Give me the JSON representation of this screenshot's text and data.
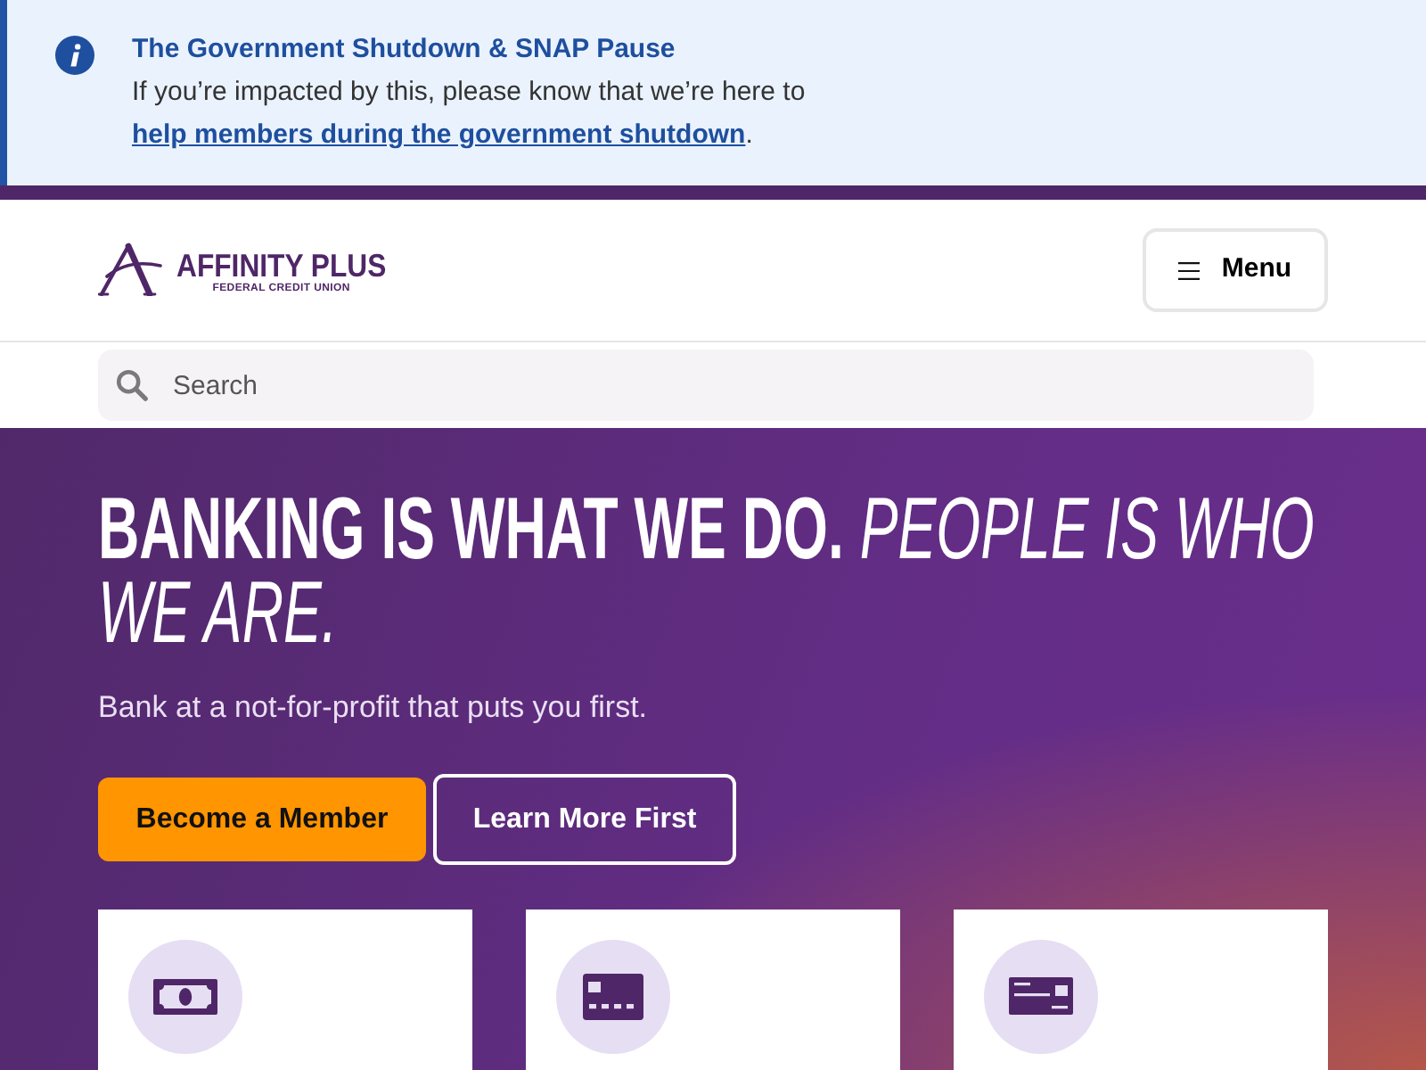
{
  "alert": {
    "title": "The Government Shutdown & SNAP Pause",
    "message": "If you’re impacted by this, please know that we’re here to ",
    "link": "help members during the government shutdown",
    "message_end": "."
  },
  "header": {
    "brand_name": "AFFINITY PLUS",
    "brand_tagline": "FEDERAL CREDIT UNION",
    "menu_button": "Menu"
  },
  "search": {
    "placeholder": "Search"
  },
  "hero": {
    "headline": "**BANKING IS WHAT WE DO.** *PEOPLE IS WHO WE ARE.*",
    "subtitle": "Bank at a not-for-profit that puts you first.",
    "buttons": [
      {
        "label": "Become a Member",
        "kind": "primary"
      },
      {
        "label": "Learn More First",
        "kind": "outline"
      }
    ]
  },
  "cards": [
    {
      "kind": "cash"
    },
    {
      "kind": "credit_card"
    },
    {
      "kind": "id_card"
    }
  ]
}
